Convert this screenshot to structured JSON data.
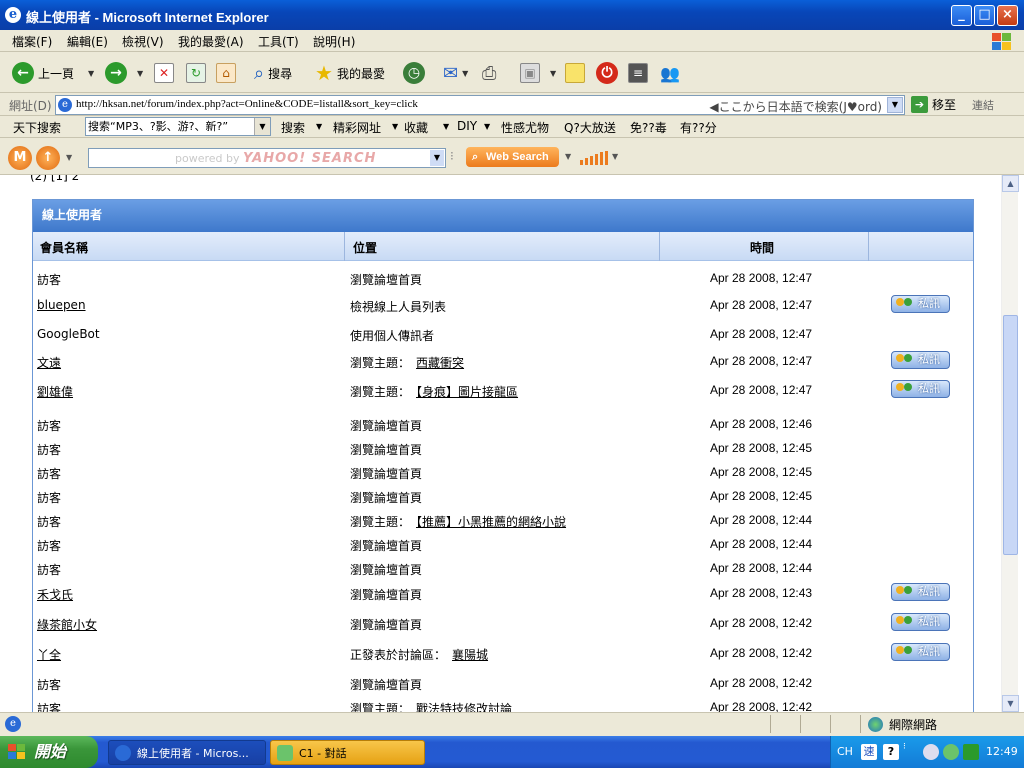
{
  "window": {
    "title": "線上使用者 - Microsoft Internet Explorer",
    "minimize": "_",
    "maximize": "□",
    "close": "×"
  },
  "menu": [
    "檔案(F)",
    "編輯(E)",
    "檢視(V)",
    "我的最愛(A)",
    "工具(T)",
    "說明(H)"
  ],
  "toolbar": {
    "back": "上一頁",
    "search": "搜尋",
    "favorites": "我的最愛"
  },
  "address": {
    "label": "網址(D)",
    "url": "http://hksan.net/forum/index.php?act=Online&CODE=listall&sort_key=click",
    "jp_search": "◀ここから日本語で検索(J♥ord)",
    "go": "移至",
    "links": "連結"
  },
  "searchbar": {
    "site_search": "天下搜索",
    "query": "搜索“MP3、?影、游?、新?”",
    "items": [
      "搜索",
      "精彩网址",
      "收藏",
      "DIY",
      "性感尤物",
      "Q?大放送",
      "免??毒",
      "有??分"
    ]
  },
  "yahoo": {
    "powered": "powered by",
    "brand": "YAHOO! SEARCH",
    "web_search": "Web Search"
  },
  "content": {
    "peek_text": "  (2) [1] 2",
    "panel_title": "線上使用者",
    "columns": {
      "member": "會員名稱",
      "location": "位置",
      "time": "時間"
    },
    "pm_label": "私訊",
    "rows": [
      {
        "member": "訪客",
        "member_link": false,
        "loc_text": "瀏覽論壇首頁",
        "loc_link": "",
        "time": "Apr 28 2008, 12:47",
        "pm": false
      },
      {
        "member": "bluepen",
        "member_link": true,
        "loc_text": "檢視線上人員列表",
        "loc_link": "",
        "time": "Apr 28 2008, 12:47",
        "pm": true
      },
      {
        "member": "GoogleBot",
        "member_link": false,
        "loc_text": "使用個人傳訊者",
        "loc_link": "",
        "time": "Apr 28 2008, 12:47",
        "pm": false
      },
      {
        "member": "文遠",
        "member_link": true,
        "loc_text": "瀏覽主題：",
        "loc_link": "西藏衝突",
        "time": "Apr 28 2008, 12:47",
        "pm": true
      },
      {
        "member": "劉雄偉",
        "member_link": true,
        "loc_text": "瀏覽主題：",
        "loc_link": "【身痕】圖片接龍區",
        "time": "Apr 28 2008, 12:47",
        "pm": true
      },
      {
        "member": "訪客",
        "member_link": false,
        "loc_text": "瀏覽論壇首頁",
        "loc_link": "",
        "time": "Apr 28 2008, 12:46",
        "pm": false
      },
      {
        "member": "訪客",
        "member_link": false,
        "loc_text": "瀏覽論壇首頁",
        "loc_link": "",
        "time": "Apr 28 2008, 12:45",
        "pm": false
      },
      {
        "member": "訪客",
        "member_link": false,
        "loc_text": "瀏覽論壇首頁",
        "loc_link": "",
        "time": "Apr 28 2008, 12:45",
        "pm": false
      },
      {
        "member": "訪客",
        "member_link": false,
        "loc_text": "瀏覽論壇首頁",
        "loc_link": "",
        "time": "Apr 28 2008, 12:45",
        "pm": false
      },
      {
        "member": "訪客",
        "member_link": false,
        "loc_text": "瀏覽主題：",
        "loc_link": "【推薦】小黑推薦的網絡小說",
        "time": "Apr 28 2008, 12:44",
        "pm": false
      },
      {
        "member": "訪客",
        "member_link": false,
        "loc_text": "瀏覽論壇首頁",
        "loc_link": "",
        "time": "Apr 28 2008, 12:44",
        "pm": false
      },
      {
        "member": "訪客",
        "member_link": false,
        "loc_text": "瀏覽論壇首頁",
        "loc_link": "",
        "time": "Apr 28 2008, 12:44",
        "pm": false
      },
      {
        "member": "禾戈氏",
        "member_link": true,
        "loc_text": "瀏覽論壇首頁",
        "loc_link": "",
        "time": "Apr 28 2008, 12:43",
        "pm": true
      },
      {
        "member": "綠茶館小女",
        "member_link": true,
        "loc_text": "瀏覽論壇首頁",
        "loc_link": "",
        "time": "Apr 28 2008, 12:42",
        "pm": true
      },
      {
        "member": "丫全",
        "member_link": true,
        "loc_text": "正發表於討論區：",
        "loc_link": "襄陽城",
        "time": "Apr 28 2008, 12:42",
        "pm": true
      },
      {
        "member": "訪客",
        "member_link": false,
        "loc_text": "瀏覽論壇首頁",
        "loc_link": "",
        "time": "Apr 28 2008, 12:42",
        "pm": false
      },
      {
        "member": "訪客",
        "member_link": false,
        "loc_text": "瀏覽主題：",
        "loc_link": "戰法特技修改討論",
        "time": "Apr 28 2008, 12:42",
        "pm": false
      }
    ]
  },
  "status": {
    "zone": "網際網路"
  },
  "taskbar": {
    "start": "開始",
    "tasks": [
      "線上使用者 - Micros...",
      "C1 - 對話"
    ],
    "lang": "CH",
    "ime": "速",
    "clock": "12:49"
  },
  "colors": {
    "panel_blue": "#3e78cb",
    "xp_blue": "#245ad2",
    "start_green": "#3a963a"
  }
}
